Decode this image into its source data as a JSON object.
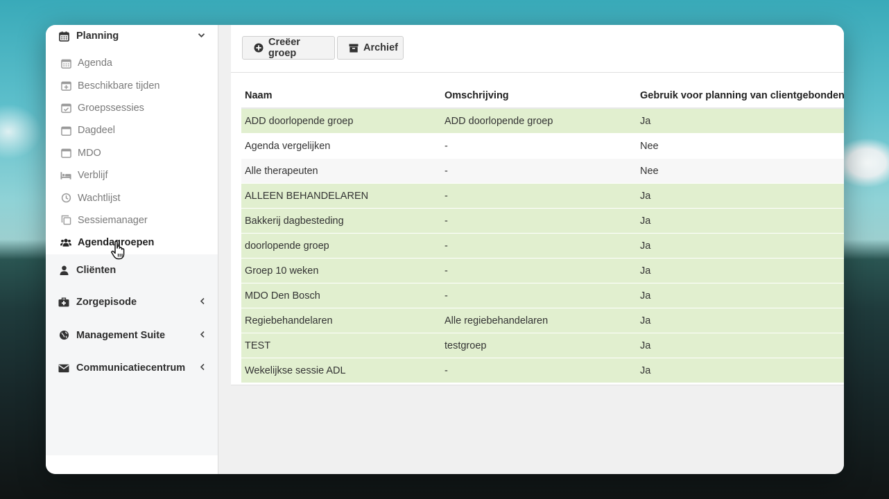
{
  "sidebar": {
    "planning": {
      "label": "Planning",
      "icon": "calendar-icon"
    },
    "items": [
      {
        "label": "Agenda",
        "icon": "calendar-icon",
        "active": false
      },
      {
        "label": "Beschikbare tijden",
        "icon": "calendar-plus-icon",
        "active": false
      },
      {
        "label": "Groepssessies",
        "icon": "calendar-check-icon",
        "active": false
      },
      {
        "label": "Dagdeel",
        "icon": "calendar-blank-icon",
        "active": false
      },
      {
        "label": "MDO",
        "icon": "calendar-blank-icon",
        "active": false
      },
      {
        "label": "Verblijf",
        "icon": "bed-icon",
        "active": false
      },
      {
        "label": "Wachtlijst",
        "icon": "clock-icon",
        "active": false
      },
      {
        "label": "Sessiemanager",
        "icon": "copy-icon",
        "active": false
      },
      {
        "label": "Agendagroepen",
        "icon": "users-icon",
        "active": true
      }
    ],
    "sections": [
      {
        "label": "Cliënten",
        "icon": "user-icon",
        "chevron": false
      },
      {
        "label": "Zorgepisode",
        "icon": "medkit-icon",
        "chevron": true
      },
      {
        "label": "Management Suite",
        "icon": "globe-icon",
        "chevron": true
      },
      {
        "label": "Communicatiecentrum",
        "icon": "envelope-icon",
        "chevron": true
      }
    ]
  },
  "toolbar": {
    "create_label": "Creëer groep",
    "archive_label": "Archief"
  },
  "table": {
    "headers": [
      "Naam",
      "Omschrijving",
      "Gebruik voor planning van clientgebonden af"
    ],
    "rows": [
      {
        "naam": "ADD doorlopende groep",
        "omschrijving": "ADD doorlopende groep",
        "gebruik": "Ja",
        "style": "green"
      },
      {
        "naam": "Agenda vergelijken",
        "omschrijving": "-",
        "gebruik": "Nee",
        "style": "white"
      },
      {
        "naam": "Alle therapeuten",
        "omschrijving": "-",
        "gebruik": "Nee",
        "style": "light"
      },
      {
        "naam": "ALLEEN BEHANDELAREN",
        "omschrijving": "-",
        "gebruik": "Ja",
        "style": "green"
      },
      {
        "naam": "Bakkerij dagbesteding",
        "omschrijving": "-",
        "gebruik": "Ja",
        "style": "green"
      },
      {
        "naam": "doorlopende groep",
        "omschrijving": "-",
        "gebruik": "Ja",
        "style": "green"
      },
      {
        "naam": "Groep 10 weken",
        "omschrijving": "-",
        "gebruik": "Ja",
        "style": "green"
      },
      {
        "naam": "MDO Den Bosch",
        "omschrijving": "-",
        "gebruik": "Ja",
        "style": "green"
      },
      {
        "naam": "Regiebehandelaren",
        "omschrijving": "Alle regiebehandelaren",
        "gebruik": "Ja",
        "style": "green"
      },
      {
        "naam": "TEST",
        "omschrijving": "testgroep",
        "gebruik": "Ja",
        "style": "green"
      },
      {
        "naam": "Wekelijkse sessie ADL",
        "omschrijving": "-",
        "gebruik": "Ja",
        "style": "green"
      }
    ]
  },
  "colors": {
    "row_green": "#e1efcf",
    "sidebar_gray": "#f5f6f7"
  }
}
